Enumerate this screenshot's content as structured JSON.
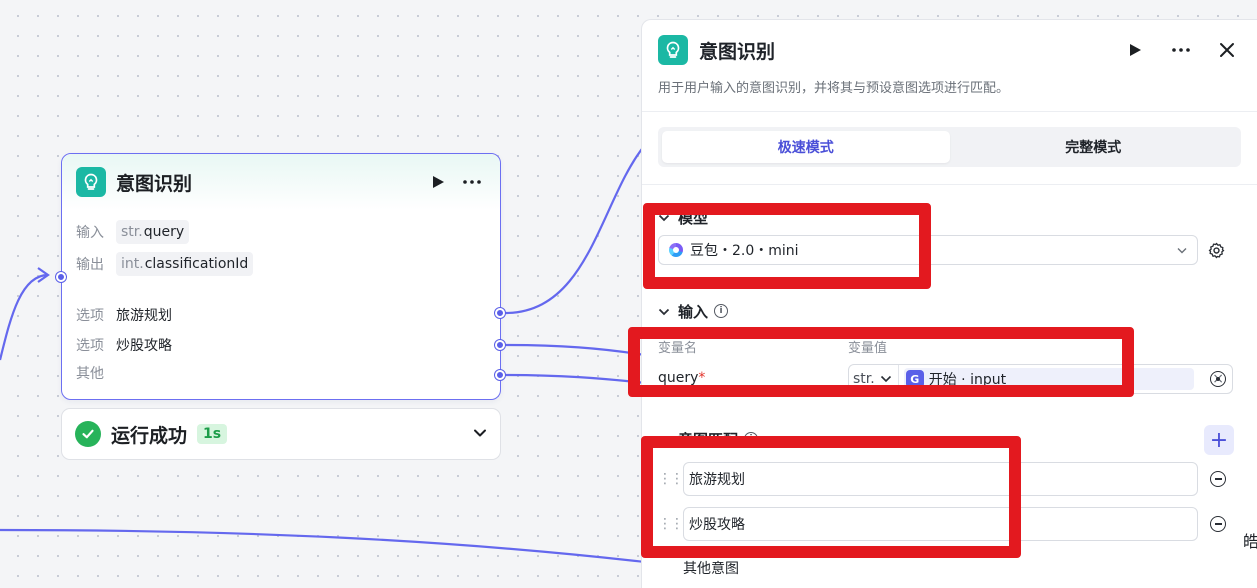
{
  "node": {
    "title": "意图识别",
    "input_label": "输入",
    "input_type": "str.",
    "input_name": "query",
    "output_label": "输出",
    "output_type": "int.",
    "output_name": "classificationId",
    "options": [
      {
        "label": "选项",
        "value": "旅游规划"
      },
      {
        "label": "选项",
        "value": "炒股攻略"
      },
      {
        "label": "其他",
        "value": ""
      }
    ]
  },
  "run_status": {
    "text": "运行成功",
    "duration": "1s"
  },
  "panel": {
    "title": "意图识别",
    "description": "用于用户输入的意图识别，并将其与预设意图选项进行匹配。",
    "modes": [
      "极速模式",
      "完整模式"
    ],
    "active_mode": "极速模式",
    "model_section": "模型",
    "model_value": "豆包・2.0・mini",
    "input_section": "输入",
    "col_name": "变量名",
    "col_value": "变量值",
    "var_name": "query",
    "var_required": "*",
    "var_type": "str.",
    "var_ref_icon": "G",
    "var_ref": "开始 · input",
    "var_clear": "×",
    "intent_section": "意图匹配",
    "intents": [
      "旅游规划",
      "炒股攻略"
    ],
    "other_intent": "其他意图",
    "add_symbol": "+"
  },
  "edge_text": "皓",
  "colors": {
    "accent": "#5a5fe8",
    "brand_teal": "#1bb8a4",
    "success": "#27b35a",
    "annotation_red": "#e3191f"
  },
  "icons": [
    "lightbulb-icon",
    "play-icon",
    "more-icon",
    "close-icon",
    "check-icon",
    "chevron-down-icon",
    "gear-icon",
    "info-icon",
    "plus-icon",
    "drag-handle-icon",
    "minus-circle-icon"
  ]
}
